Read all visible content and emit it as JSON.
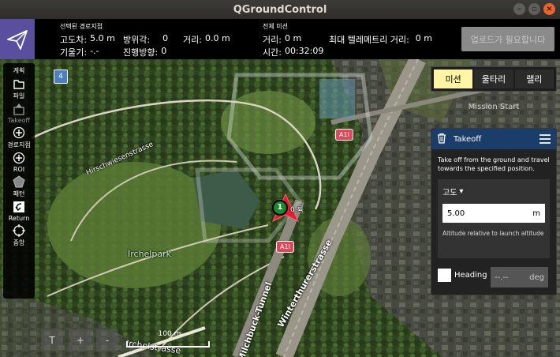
{
  "window": {
    "title": "QGroundControl"
  },
  "toolbar": {
    "selected_caption": "선택된 경로지점",
    "altdiff_label": "고도차:",
    "altdiff_value": "5.0 m",
    "azimuth_label": "방위각:",
    "azimuth_value": "0",
    "dist_label": "거리:",
    "dist_value": "0.0 m",
    "gradient_label": "기울기:",
    "gradient_value": "-.-",
    "heading_label": "진행방향:",
    "heading_value": "0",
    "total_caption": "전체 미션",
    "total_dist_label": "거리:",
    "total_dist_value": "0 m",
    "max_telem_label": "최대 텔레메트리 거리:",
    "max_telem_value": "0 m",
    "time_label": "시간:",
    "time_value": "00:32:09",
    "upload_label": "업로드가 필요합니다"
  },
  "left_tools": [
    {
      "label": "계획",
      "icon": "plan-icon",
      "disabled": false
    },
    {
      "label": "파일",
      "icon": "file-icon",
      "disabled": false
    },
    {
      "label": "Takeoff",
      "icon": "takeoff-icon",
      "disabled": true
    },
    {
      "label": "경로지점",
      "icon": "waypoint-icon",
      "disabled": false
    },
    {
      "label": "ROI",
      "icon": "roi-icon",
      "disabled": false
    },
    {
      "label": "패턴",
      "icon": "pattern-icon",
      "disabled": false
    },
    {
      "label": "Return",
      "icon": "return-icon",
      "disabled": false
    },
    {
      "label": "중앙",
      "icon": "center-icon",
      "disabled": false
    }
  ],
  "right_panel": {
    "tabs": [
      "미션",
      "울타리",
      "랠리"
    ],
    "active_tab": 0,
    "mission_start": "Mission Start",
    "takeoff": {
      "title": "Takeoff",
      "description": "Take off from the ground and travel towards the specified position.",
      "altitude_label": "고도",
      "altitude_value": "5.00",
      "altitude_unit": "m",
      "altitude_hint": "Altitude relative to launch altitude",
      "heading_label": "Heading",
      "heading_value": "--.--",
      "heading_unit": "deg"
    }
  },
  "map": {
    "labels": {
      "irchelpark": "Irchelpark",
      "hirschwiesen": "Hirschwiesenstrasse",
      "winterthurer": "Winterthurerstrasse",
      "milchbuck": "Milchbuck-Tunnel",
      "irchelstrasse": "Irchelstrasse"
    },
    "road_badge": "A1l",
    "badge_4": "4",
    "vehicle_marker": "1",
    "vehicle_label": "0 륙",
    "scale_label": "100 m",
    "zoom_buttons": [
      "T",
      "+",
      "-"
    ]
  },
  "colors": {
    "logo_bg": "#5a4f9e",
    "tab_active": "#fff5a5",
    "takeoff_header": "#1a3d6a",
    "road_badge": "#d94a5a"
  }
}
